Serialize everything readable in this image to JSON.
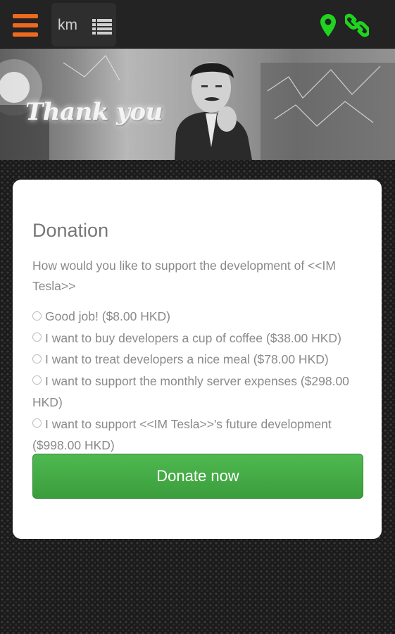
{
  "topbar": {
    "unit_label": "km",
    "icons": [
      "menu-icon",
      "list-icon",
      "location-pin-icon",
      "link-icon"
    ],
    "accent_color": "#ef6a1e",
    "icon_color": "#1fd31f"
  },
  "banner": {
    "text": "Thank you"
  },
  "card": {
    "title": "Donation",
    "question": "How would you like to support the development of <<IM Tesla>>",
    "options": [
      {
        "label": "Good job! ($8.00 HKD)"
      },
      {
        "label": "I want to buy developers a cup of coffee ($38.00 HKD)"
      },
      {
        "label": "I want to treat developers a nice meal ($78.00 HKD)"
      },
      {
        "label": "I want to support the monthly server expenses ($298.00 HKD)"
      },
      {
        "label": "I want to support <<IM Tesla>>'s future development ($998.00 HKD)"
      }
    ],
    "donate_label": "Donate now",
    "button_color": "#44ab46"
  }
}
